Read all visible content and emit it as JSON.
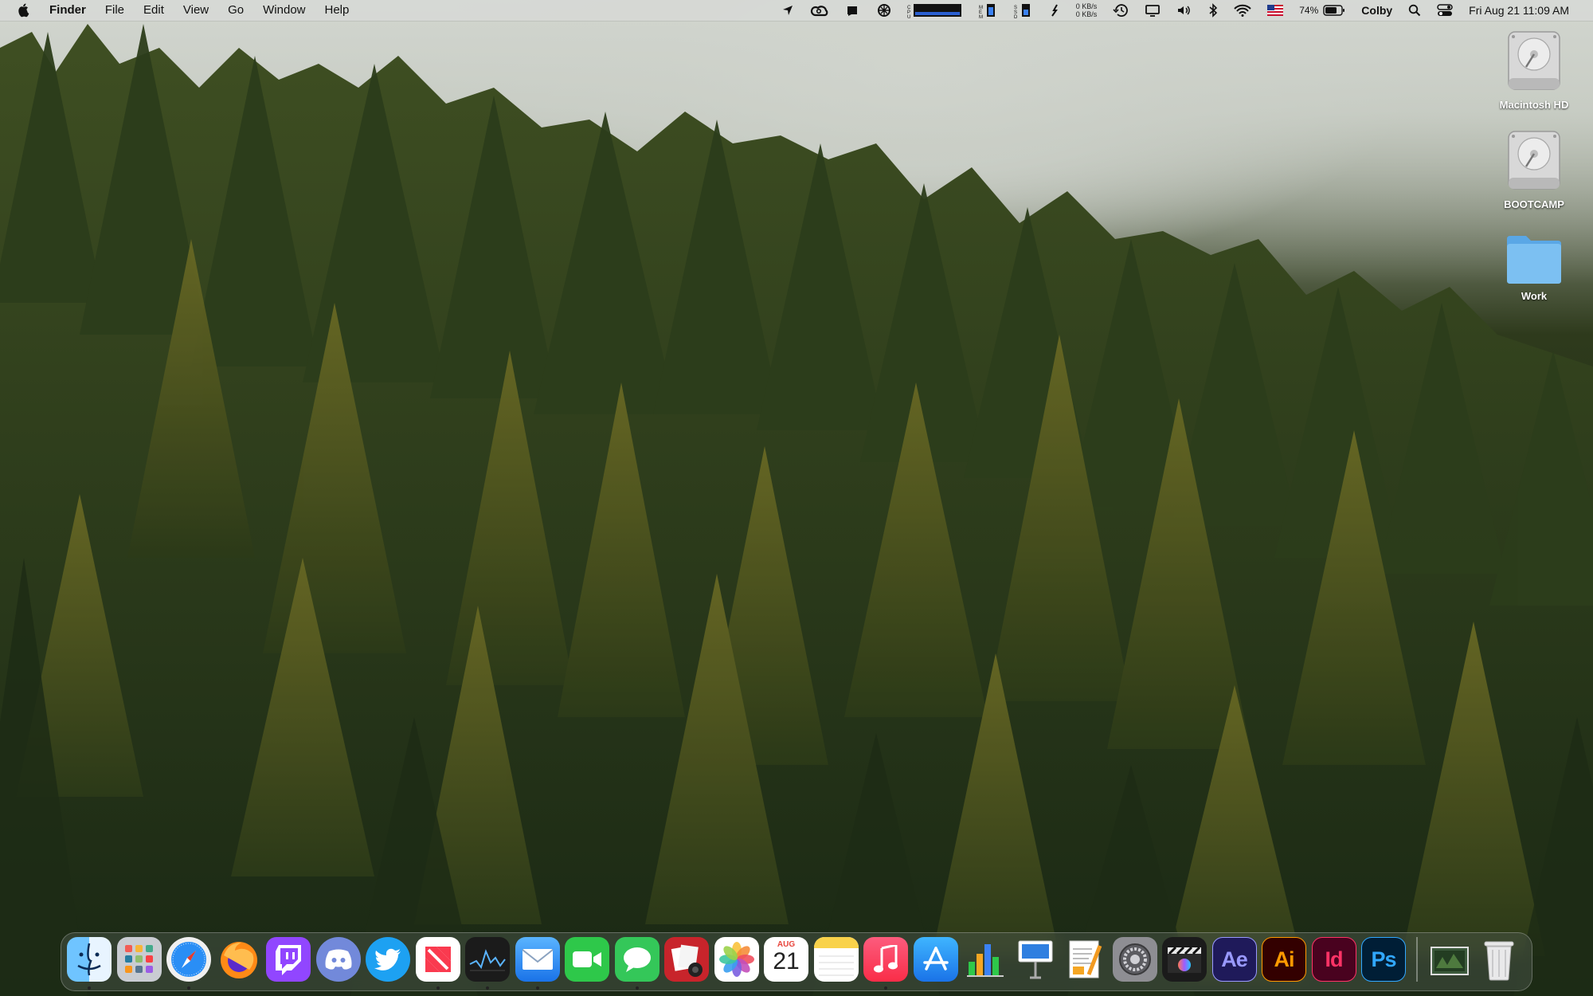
{
  "menubar": {
    "app_name": "Finder",
    "menus": [
      "File",
      "Edit",
      "View",
      "Go",
      "Window",
      "Help"
    ],
    "network_up": "0 KB/s",
    "network_down": "0 KB/s",
    "battery_percent": "74%",
    "user_name": "Colby",
    "datetime": "Fri Aug 21  11:09 AM",
    "status_icons": [
      "location-icon",
      "creative-cloud-icon",
      "notification-icon",
      "istat-icon",
      "cpu-meter-icon",
      "memory-meter-icon",
      "ssd-meter-icon",
      "sensor-icon",
      "network-meter-icon",
      "time-machine-icon",
      "airplay-display-icon",
      "volume-icon",
      "bluetooth-icon",
      "wifi-icon",
      "input-source-flag-icon",
      "battery-icon",
      "spotlight-icon",
      "control-center-icon"
    ],
    "flag_colors": {
      "red": "#c8102e",
      "blue": "#1f3b8c"
    }
  },
  "desktop": {
    "icons": [
      {
        "label": "Macintosh HD",
        "icon": "hard-drive-icon"
      },
      {
        "label": "BOOTCAMP",
        "icon": "hard-drive-icon"
      },
      {
        "label": "Work",
        "icon": "folder-icon"
      }
    ],
    "folder_color": "#6fb7ee"
  },
  "dock": {
    "apps": [
      {
        "name": "Finder",
        "running": true
      },
      {
        "name": "Launchpad",
        "running": false
      },
      {
        "name": "Safari",
        "running": true
      },
      {
        "name": "Firefox",
        "running": false
      },
      {
        "name": "Twitch",
        "running": false
      },
      {
        "name": "Discord",
        "running": false
      },
      {
        "name": "Twitter",
        "running": false
      },
      {
        "name": "News",
        "running": true
      },
      {
        "name": "Stocks",
        "running": true
      },
      {
        "name": "Mail",
        "running": true
      },
      {
        "name": "FaceTime",
        "running": false
      },
      {
        "name": "Messages",
        "running": true
      },
      {
        "name": "Photo Booth",
        "running": false
      },
      {
        "name": "Photos",
        "running": false
      },
      {
        "name": "Calendar",
        "running": false
      },
      {
        "name": "Notes",
        "running": false
      },
      {
        "name": "Music",
        "running": true
      },
      {
        "name": "App Store",
        "running": false
      },
      {
        "name": "Numbers",
        "running": false
      },
      {
        "name": "Keynote",
        "running": false
      },
      {
        "name": "Pages",
        "running": false
      },
      {
        "name": "System Preferences",
        "running": false
      },
      {
        "name": "Final Cut Pro",
        "running": false
      },
      {
        "name": "After Effects",
        "running": false
      },
      {
        "name": "Illustrator",
        "running": false
      },
      {
        "name": "InDesign",
        "running": false
      },
      {
        "name": "Photoshop",
        "running": false
      }
    ],
    "calendar_month": "AUG",
    "calendar_day": "21",
    "ae_label": "Ae",
    "ai_label": "Ai",
    "id_label": "Id",
    "ps_label": "Ps",
    "extras": [
      "Downloads stack",
      "Trash"
    ]
  }
}
